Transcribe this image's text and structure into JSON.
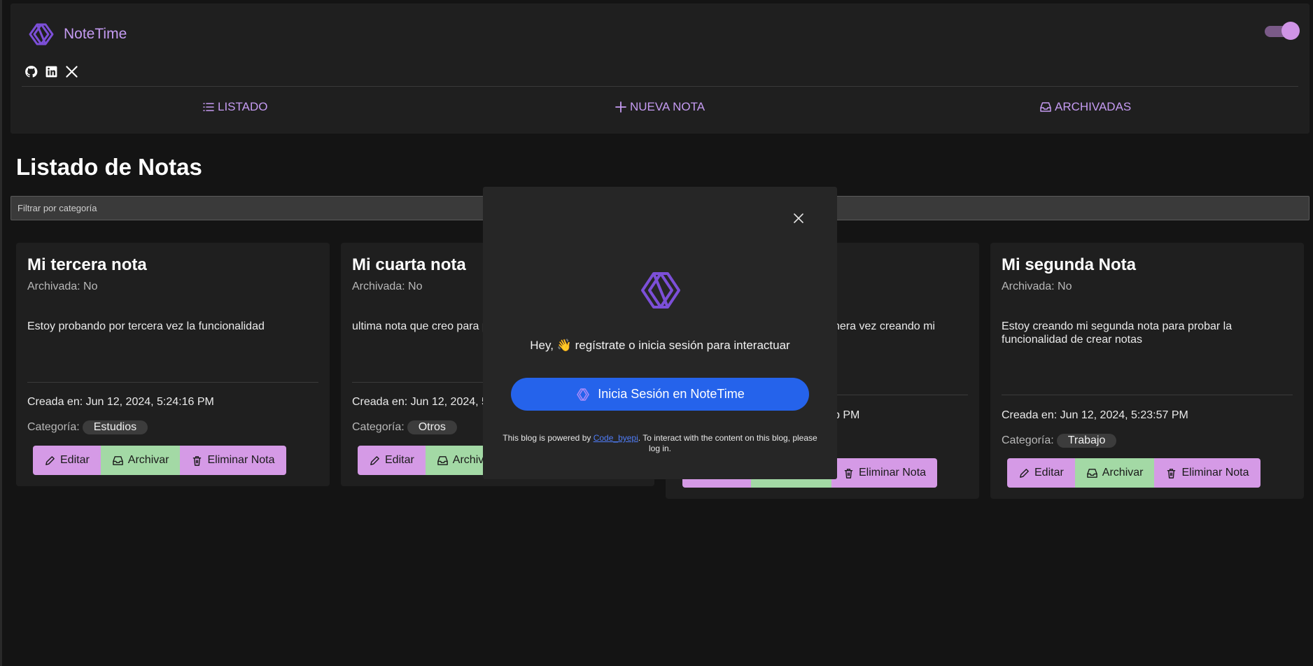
{
  "app": {
    "name": "NoteTime"
  },
  "nav": [
    {
      "label": "LISTADO",
      "icon": "list-icon"
    },
    {
      "label": "NUEVA NOTA",
      "icon": "plus-icon"
    },
    {
      "label": "ARCHIVADAS",
      "icon": "inbox-icon"
    }
  ],
  "socials": [
    "github-icon",
    "linkedin-icon",
    "x-icon"
  ],
  "main": {
    "title": "Listado de Notas",
    "filter_placeholder": "Filtrar por categoría"
  },
  "notes": [
    {
      "title": "Mi tercera nota",
      "archived": "Archivada: No",
      "body": "Estoy probando por tercera vez la funcionalidad",
      "created": "Creada en: Jun 12, 2024, 5:24:16 PM",
      "category_label": "Categoría:",
      "category": "Estudios"
    },
    {
      "title": "Mi cuarta nota",
      "archived": "Archivada: No",
      "body": "ultima nota que creo para p",
      "created": "Creada en: Jun 12, 2024, 5",
      "category_label": "Categoría:",
      "category": "Otros"
    },
    {
      "title": "",
      "archived": "",
      "body": "nera vez creando mi",
      "created": "b PM",
      "category_label": "",
      "category": ""
    },
    {
      "title": "Mi segunda Nota",
      "archived": "Archivada: No",
      "body": "Estoy creando mi segunda nota para probar la funcionalidad de crear notas",
      "created": "Creada en: Jun 12, 2024, 5:23:57 PM",
      "category_label": "Categoría:",
      "category": "Trabajo"
    }
  ],
  "buttons": {
    "edit": "Editar",
    "archive": "Archivar",
    "archive_partial": "Archiv",
    "delete": "Eliminar Nota"
  },
  "modal": {
    "greeting": "Hey, 👋 regístrate o inicia sesión para interactuar",
    "login_label": "Inicia Sesión en NoteTime",
    "footer_prefix": "This blog is powered by ",
    "footer_link": "Code_byepi",
    "footer_suffix": ". To interact with the content on this blog, please log in."
  },
  "colors": {
    "accent": "#c59bf2",
    "button_purple": "#d59ae6",
    "button_green": "#a3d9a5",
    "login_blue": "#2563eb",
    "background": "#141414",
    "surface": "#1f1f1f"
  }
}
